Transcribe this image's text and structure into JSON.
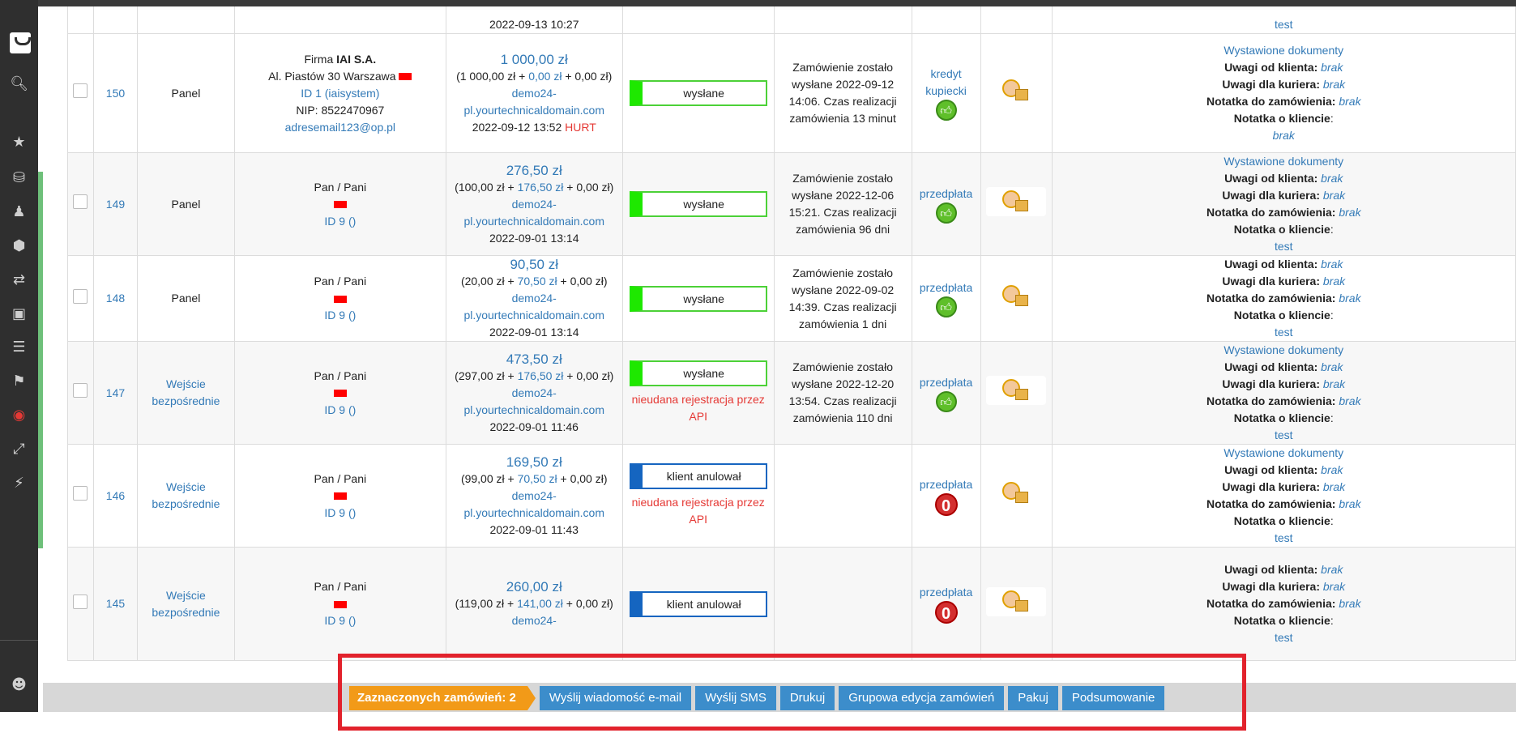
{
  "top_row": {
    "date": "2022-09-13 10:27",
    "note_client": "test"
  },
  "orders": [
    {
      "id": "150",
      "source": "Panel",
      "client": {
        "line1_prefix": "Firma ",
        "line1_bold": "IAI S.A.",
        "address": "Al. Piastów 30 Warszawa",
        "client_id": "ID 1 (iaisystem)",
        "nip": "NIP: 8522470967",
        "email": "adresemail123@op.pl"
      },
      "amount": "1 000,00 zł",
      "breakdown_a": "(1 000,00 zł + ",
      "breakdown_b": "0,00 zł",
      "breakdown_c": " + 0,00 zł)",
      "shop": "demo24-pl.yourtechnicaldomain.com",
      "date": "2022-09-12 13:52",
      "tag": "HURT",
      "status": "wysłane",
      "status_error": "",
      "info": "Zamówienie zostało wysłane 2022-09-12 14:06. Czas realizacji zamówienia 13 minut",
      "payment": "kredyt kupiecki",
      "payment_icon": "thumbs-up-icon",
      "docs": "Wystawione dokumenty"
    },
    {
      "id": "149",
      "source": "Panel",
      "client": {
        "salutation": "Pan / Pani",
        "client_id": "ID 9 ()"
      },
      "amount": "276,50 zł",
      "breakdown_a": "(100,00 zł + ",
      "breakdown_b": "176,50 zł",
      "breakdown_c": " + 0,00 zł)",
      "shop": "demo24-pl.yourtechnicaldomain.com",
      "date": "2022-09-01 13:14",
      "tag": "",
      "status": "wysłane",
      "status_error": "",
      "info": "Zamówienie zostało wysłane 2022-12-06 15:21. Czas realizacji zamówienia 96 dni",
      "payment": "przedpłata",
      "payment_icon": "thumbs-up-icon",
      "docs": "Wystawione dokumenty"
    },
    {
      "id": "148",
      "source": "Panel",
      "client": {
        "salutation": "Pan / Pani",
        "client_id": "ID 9 ()"
      },
      "amount": "90,50 zł",
      "breakdown_a": "(20,00 zł + ",
      "breakdown_b": "70,50 zł",
      "breakdown_c": " + 0,00 zł)",
      "shop": "demo24-pl.yourtechnicaldomain.com",
      "date": "2022-09-01 13:14",
      "tag": "",
      "status": "wysłane",
      "status_error": "",
      "info": "Zamówienie zostało wysłane 2022-09-02 14:39. Czas realizacji zamówienia 1 dni",
      "payment": "przedpłata",
      "payment_icon": "thumbs-up-icon",
      "docs": ""
    },
    {
      "id": "147",
      "source": "Wejście bezpośrednie",
      "client": {
        "salutation": "Pan / Pani",
        "client_id": "ID 9 ()"
      },
      "amount": "473,50 zł",
      "breakdown_a": "(297,00 zł + ",
      "breakdown_b": "176,50 zł",
      "breakdown_c": " + 0,00 zł)",
      "shop": "demo24-pl.yourtechnicaldomain.com",
      "date": "2022-09-01 11:46",
      "tag": "",
      "status": "wysłane",
      "status_error": "nieudana rejestracja przez API",
      "info": "Zamówienie zostało wysłane 2022-12-20 13:54. Czas realizacji zamówienia 110 dni",
      "payment": "przedpłata",
      "payment_icon": "thumbs-up-icon",
      "docs": "Wystawione dokumenty"
    },
    {
      "id": "146",
      "source": "Wejście bezpośrednie",
      "client": {
        "salutation": "Pan / Pani",
        "client_id": "ID 9 ()"
      },
      "amount": "169,50 zł",
      "breakdown_a": "(99,00 zł + ",
      "breakdown_b": "70,50 zł",
      "breakdown_c": " + 0,00 zł)",
      "shop": "demo24-pl.yourtechnicaldomain.com",
      "date": "2022-09-01 11:43",
      "tag": "",
      "status": "klient anulował",
      "status_error": "nieudana rejestracja przez API",
      "info": "",
      "payment": "przedpłata",
      "payment_icon": "zero-icon",
      "docs": "Wystawione dokumenty"
    },
    {
      "id": "145",
      "source": "Wejście bezpośrednie",
      "client": {
        "salutation": "Pan / Pani",
        "client_id": "ID 9 ()"
      },
      "amount": "260,00 zł",
      "breakdown_a": "(119,00 zł + ",
      "breakdown_b": "141,00 zł",
      "breakdown_c": " + 0,00 zł)",
      "shop": "demo24-",
      "date": "",
      "tag": "",
      "status": "klient anulował",
      "status_error": "",
      "info": "",
      "payment": "przedpłata",
      "payment_icon": "zero-icon",
      "docs": ""
    }
  ],
  "notes_labels": {
    "from_client": "Uwagi od klienta:",
    "for_courier": "Uwagi dla kuriera:",
    "order_note": "Notatka do zamówienia:",
    "client_note": "Notatka o kliencie",
    "none": "brak",
    "test": "test",
    "colon": ":"
  },
  "bottom_bar": {
    "selected": "Zaznaczonych zamówień: 2",
    "send_email": "Wyślij wiadomość e-mail",
    "send_sms": "Wyślij SMS",
    "print": "Drukuj",
    "group_edit": "Grupowa edycja zamówień",
    "pack": "Pakuj",
    "summary": "Podsumowanie"
  },
  "sidebar_icons": [
    "search-icon",
    "star-icon",
    "coins-icon",
    "users-icon",
    "box-icon",
    "routes-icon",
    "camera-icon",
    "layers-icon",
    "tags-icon",
    "globe-icon",
    "expand-icon",
    "bolt-icon",
    "user-circle-icon"
  ],
  "colors": {
    "accent_blue": "#3c8dcb",
    "selected_orange": "#f29a18",
    "status_green": "#1ee800",
    "status_cancel": "#1565c0",
    "error_red": "#e53935",
    "highlight_red": "#e2222c"
  }
}
